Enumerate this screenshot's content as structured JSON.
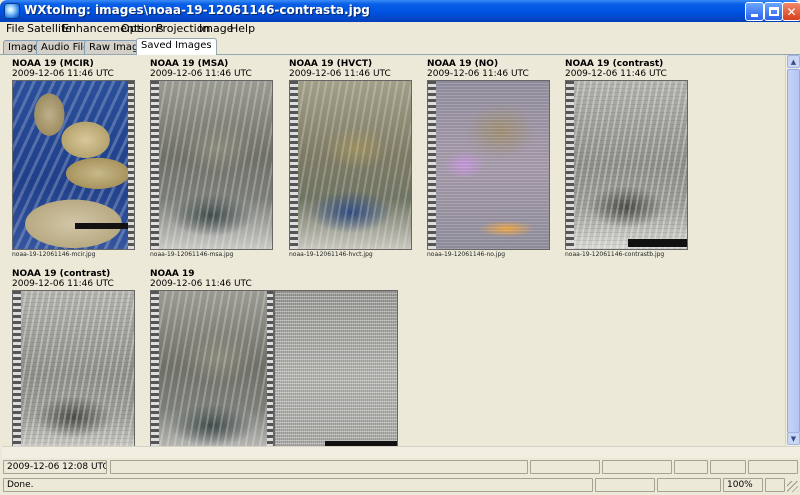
{
  "window": {
    "title": "WXtoImg: images\\noaa-19-12061146-contrasta.jpg"
  },
  "menu": [
    "File",
    "Satellite",
    "Enhancements",
    "Options",
    "Projection",
    "Image",
    "Help"
  ],
  "tabs": [
    {
      "label": "Image",
      "active": false
    },
    {
      "label": "Audio Files",
      "active": false
    },
    {
      "label": "Raw Images",
      "active": false
    },
    {
      "label": "Saved Images",
      "active": true
    }
  ],
  "images": [
    {
      "title": "NOAA 19 (MCIR)",
      "date": "2009-12-06  11:46 UTC",
      "file": "noaa-19-12061146-mcir.jpg",
      "style": "t-mcir"
    },
    {
      "title": "NOAA 19 (MSA)",
      "date": "2009-12-06  11:46 UTC",
      "file": "noaa-19-12061146-msa.jpg",
      "style": "t-msa"
    },
    {
      "title": "NOAA 19 (HVCT)",
      "date": "2009-12-06  11:46 UTC",
      "file": "noaa-19-12061146-hvct.jpg",
      "style": "t-hvct"
    },
    {
      "title": "NOAA 19 (NO)",
      "date": "2009-12-06  11:46 UTC",
      "file": "noaa-19-12061146-no.jpg",
      "style": "t-no"
    },
    {
      "title": "NOAA 19 (contrast)",
      "date": "2009-12-06  11:46 UTC",
      "file": "noaa-19-12061146-contrastb.jpg",
      "style": "t-con"
    },
    {
      "title": "NOAA 19 (contrast)",
      "date": "2009-12-06  11:46 UTC",
      "file": "",
      "style": "t-con"
    },
    {
      "title": "NOAA 19",
      "date": "2009-12-06  11:46 UTC",
      "file": "",
      "style": "t-msa"
    }
  ],
  "status": {
    "time": "2009-12-06 12:08 UTC",
    "message": "Done.",
    "zoom": "100%"
  },
  "colors": {
    "titlebar": "#0054e3",
    "window_bg": "#ece9d8",
    "tab_border": "#91a7b4"
  },
  "icons": {
    "app": "wxtoimg-satellite-icon",
    "minimize": "minimize-icon",
    "maximize": "maximize-icon",
    "close": "close-icon"
  }
}
